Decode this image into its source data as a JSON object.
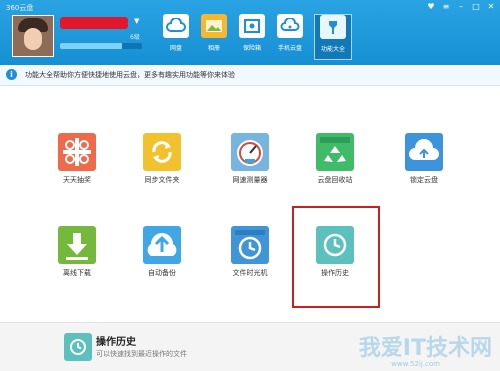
{
  "app": {
    "title": "360云盘"
  },
  "user": {
    "level": "6级",
    "quota_fraction": 0.75
  },
  "nav": [
    {
      "label": "网盘",
      "icon": "cloud-icon"
    },
    {
      "label": "相册",
      "icon": "photo-icon"
    },
    {
      "label": "保险箱",
      "icon": "safe-icon"
    },
    {
      "label": "手机云盘",
      "icon": "phone-cloud-icon"
    },
    {
      "label": "功能大全",
      "icon": "toolbox-icon"
    }
  ],
  "notice": {
    "text": "功能大全帮助你方便快捷地使用云盘，更多有趣实用功能等你来体验"
  },
  "features": [
    {
      "label": "天天抽奖",
      "icon": "lottery-icon",
      "color": "#ee6a4b"
    },
    {
      "label": "同步文件夹",
      "icon": "sync-folder-icon",
      "color": "#f2c12e"
    },
    {
      "label": "网速测量器",
      "icon": "speedometer-icon",
      "color": "#78b5de"
    },
    {
      "label": "云盘回收站",
      "icon": "recycle-icon",
      "color": "#3fbb6a"
    },
    {
      "label": "锁定云盘",
      "icon": "lock-cloud-icon",
      "color": "#3d93dc"
    },
    {
      "label": "离线下载",
      "icon": "download-icon",
      "color": "#74b83c"
    },
    {
      "label": "自动备份",
      "icon": "backup-icon",
      "color": "#3fa7e6"
    },
    {
      "label": "文件时光机",
      "icon": "time-machine-icon",
      "color": "#3f95d6"
    },
    {
      "label": "操作历史",
      "icon": "history-clock-icon",
      "color": "#5cc0bd"
    }
  ],
  "footer": {
    "title": "操作历史",
    "description": "可以快速找到最近操作的文件"
  },
  "watermark": {
    "text": "我爱IT技术网",
    "url": "www.52ij.com"
  }
}
